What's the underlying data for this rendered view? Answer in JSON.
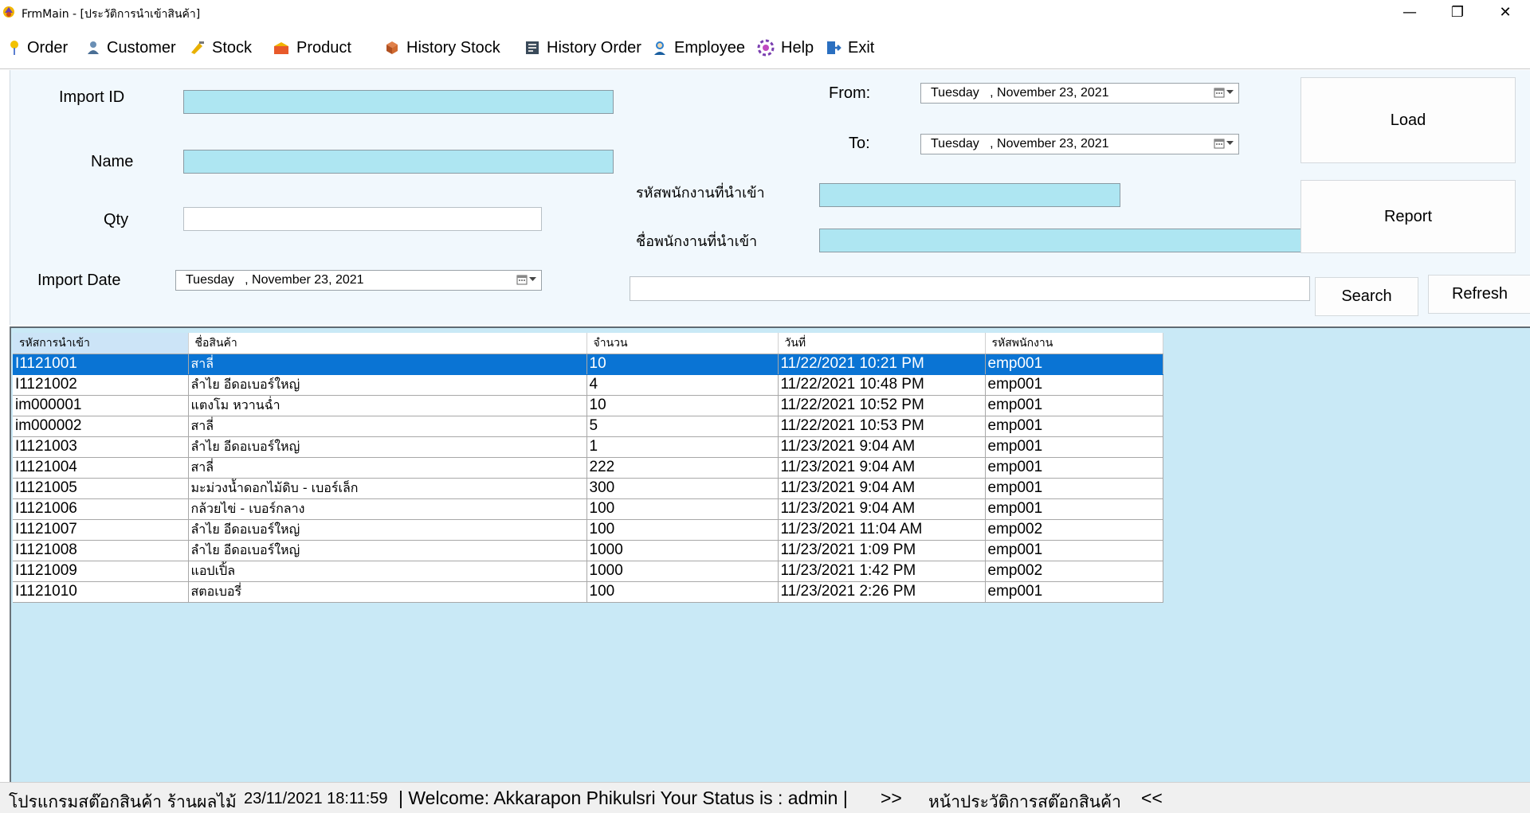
{
  "window": {
    "title": "FrmMain - [ประวัติการนำเข้าสินค้า]",
    "controls": {
      "minimize": "—",
      "restore": "❐",
      "close": "✕"
    }
  },
  "menu": {
    "items": [
      {
        "label": "Order",
        "icon": "pin-icon"
      },
      {
        "label": "Customer",
        "icon": "customer-icon"
      },
      {
        "label": "Stock",
        "icon": "stock-icon"
      },
      {
        "label": "Product",
        "icon": "product-icon"
      },
      {
        "label": "History Stock",
        "icon": "box-icon"
      },
      {
        "label": "History Order",
        "icon": "ledger-icon"
      },
      {
        "label": "Employee",
        "icon": "employee-icon"
      },
      {
        "label": "Help",
        "icon": "help-icon"
      },
      {
        "label": "Exit",
        "icon": "exit-icon"
      }
    ]
  },
  "form": {
    "import_id_label": "Import ID",
    "name_label": "Name",
    "qty_label": "Qty",
    "import_date_label": "Import Date",
    "import_date": {
      "day": "Tuesday   ,",
      "date": "November  23, 2021"
    },
    "from_label": "From:",
    "from_date": {
      "day": "Tuesday   ,",
      "date": "November  23, 2021"
    },
    "to_label": "To:",
    "to_date": {
      "day": "Tuesday   ,",
      "date": "November  23, 2021"
    },
    "emp_id_label": "รหัสพนักงานที่นำเข้า",
    "emp_name_label": "ชื่อพนักงานที่นำเข้า",
    "import_id_value": "",
    "name_value": "",
    "qty_value": "",
    "emp_id_value": "",
    "emp_name_value": "",
    "search_value": "",
    "buttons": {
      "load": "Load",
      "report": "Report",
      "search": "Search",
      "refresh": "Refresh"
    }
  },
  "grid": {
    "columns": [
      "รหัสการนำเข้า",
      "ชื่อสินค้า",
      "จำนวน",
      "วันที่",
      "รหัสพนักงาน"
    ],
    "rows": [
      [
        "I1121001",
        "สาลี่",
        "10",
        "11/22/2021 10:21 PM",
        "emp001"
      ],
      [
        "I1121002",
        "ลำไย อีดอเบอร์ใหญ่",
        "4",
        "11/22/2021 10:48 PM",
        "emp001"
      ],
      [
        "im000001",
        "แตงโม หวานฉ่ำ",
        "10",
        "11/22/2021 10:52 PM",
        "emp001"
      ],
      [
        "im000002",
        "สาลี่",
        "5",
        "11/22/2021 10:53 PM",
        "emp001"
      ],
      [
        "I1121003",
        "ลำไย อีดอเบอร์ใหญ่",
        "1",
        "11/23/2021 9:04 AM",
        "emp001"
      ],
      [
        "I1121004",
        "สาลี่",
        "222",
        "11/23/2021 9:04 AM",
        "emp001"
      ],
      [
        "I1121005",
        "มะม่วงน้ำดอกไม้ดิบ - เบอร์เล็ก",
        "300",
        "11/23/2021 9:04 AM",
        "emp001"
      ],
      [
        "I1121006",
        "กล้วยไข่ - เบอร์กลาง",
        "100",
        "11/23/2021 9:04 AM",
        "emp001"
      ],
      [
        "I1121007",
        "ลำไย อีดอเบอร์ใหญ่",
        "100",
        "11/23/2021 11:04 AM",
        "emp002"
      ],
      [
        "I1121008",
        "ลำไย อีดอเบอร์ใหญ่",
        "1000",
        "11/23/2021 1:09 PM",
        "emp001"
      ],
      [
        "I1121009",
        "แอปเปิ้ล",
        "1000",
        "11/23/2021 1:42 PM",
        "emp002"
      ],
      [
        "I1121010",
        "สตอเบอรี่",
        "100",
        "11/23/2021 2:26 PM",
        "emp001"
      ]
    ],
    "selected_row": 0
  },
  "status": {
    "app_name": "โปรแกรมสต๊อกสินค้า ร้านผลไม้",
    "datetime": "23/11/2021 18:11:59",
    "welcome": "| Welcome: Akkarapon Phikulsri Your Status is : admin |",
    "arrow_open": ">>",
    "page_name": "หน้าประวัติการสต๊อกสินค้า",
    "arrow_close": "<<"
  },
  "colors": {
    "input_cyan": "#aee6f2",
    "selection": "#0a74d4",
    "grid_background": "#c9e9f6",
    "form_background": "#f1f8fd"
  }
}
